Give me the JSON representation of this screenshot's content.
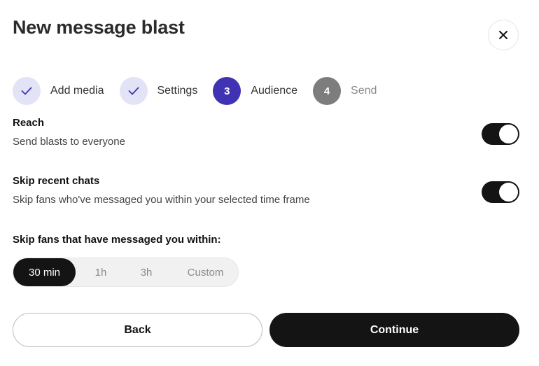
{
  "dialog": {
    "title": "New message blast",
    "close_icon": "close-icon"
  },
  "steps": [
    {
      "label": "Add media",
      "status": "done",
      "icon": "check-icon"
    },
    {
      "label": "Settings",
      "status": "done",
      "icon": "check-icon"
    },
    {
      "label": "Audience",
      "status": "active",
      "number": "3"
    },
    {
      "label": "Send",
      "status": "pending",
      "number": "4"
    }
  ],
  "reach": {
    "title": "Reach",
    "description": "Send blasts to everyone",
    "enabled": true
  },
  "skip_recent": {
    "title": "Skip recent chats",
    "description": "Skip fans who've messaged you within your selected time frame",
    "enabled": true
  },
  "time_frame": {
    "label": "Skip fans that have messaged you within:",
    "options": [
      "30 min",
      "1h",
      "3h",
      "Custom"
    ],
    "selected": "30 min"
  },
  "actions": {
    "back_label": "Back",
    "continue_label": "Continue"
  },
  "colors": {
    "accent": "#3f33b4",
    "done_step_bg": "#e3e3f7",
    "pending_step_bg": "#7d7d7d",
    "primary_button": "#141414"
  }
}
